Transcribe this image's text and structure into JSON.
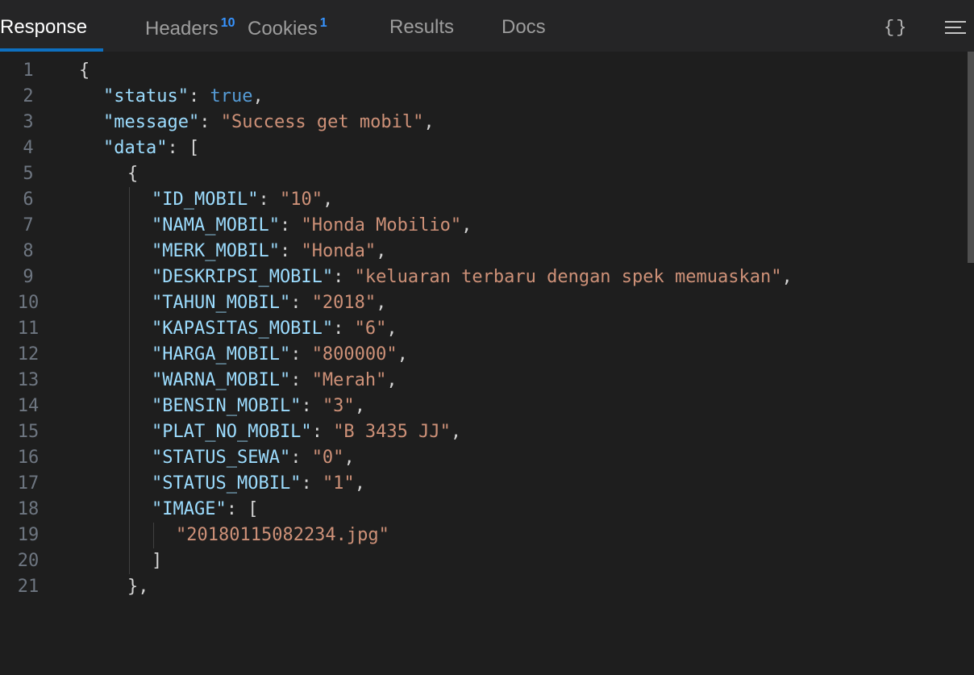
{
  "tabs": [
    {
      "label": "Response",
      "badge": "",
      "active": true
    },
    {
      "label": "Headers",
      "badge": "10",
      "active": false
    },
    {
      "label": "Cookies",
      "badge": "1",
      "active": false
    },
    {
      "label": "Results",
      "badge": "",
      "active": false
    },
    {
      "label": "Docs",
      "badge": "",
      "active": false
    }
  ],
  "toolbar": {
    "format_icon": "{}",
    "menu_icon": "hamburger-lines"
  },
  "editor": {
    "lines": [
      {
        "num": "1",
        "indent": 0,
        "tokens": [
          [
            "p",
            "{"
          ]
        ]
      },
      {
        "num": "2",
        "indent": 1,
        "tokens": [
          [
            "k",
            "\"status\""
          ],
          [
            "p",
            ": "
          ],
          [
            "b",
            "true"
          ],
          [
            "p",
            ","
          ]
        ]
      },
      {
        "num": "3",
        "indent": 1,
        "tokens": [
          [
            "k",
            "\"message\""
          ],
          [
            "p",
            ": "
          ],
          [
            "s",
            "\"Success get mobil\""
          ],
          [
            "p",
            ","
          ]
        ]
      },
      {
        "num": "4",
        "indent": 1,
        "tokens": [
          [
            "k",
            "\"data\""
          ],
          [
            "p",
            ": ["
          ]
        ]
      },
      {
        "num": "5",
        "indent": 2,
        "tokens": [
          [
            "p",
            "{"
          ]
        ]
      },
      {
        "num": "6",
        "indent": 3,
        "tokens": [
          [
            "k",
            "\"ID_MOBIL\""
          ],
          [
            "p",
            ": "
          ],
          [
            "s",
            "\"10\""
          ],
          [
            "p",
            ","
          ]
        ]
      },
      {
        "num": "7",
        "indent": 3,
        "tokens": [
          [
            "k",
            "\"NAMA_MOBIL\""
          ],
          [
            "p",
            ": "
          ],
          [
            "s",
            "\"Honda Mobilio\""
          ],
          [
            "p",
            ","
          ]
        ]
      },
      {
        "num": "8",
        "indent": 3,
        "tokens": [
          [
            "k",
            "\"MERK_MOBIL\""
          ],
          [
            "p",
            ": "
          ],
          [
            "s",
            "\"Honda\""
          ],
          [
            "p",
            ","
          ]
        ]
      },
      {
        "num": "9",
        "indent": 3,
        "tokens": [
          [
            "k",
            "\"DESKRIPSI_MOBIL\""
          ],
          [
            "p",
            ": "
          ],
          [
            "s",
            "\"keluaran terbaru dengan spek memuaskan\""
          ],
          [
            "p",
            ","
          ]
        ]
      },
      {
        "num": "10",
        "indent": 3,
        "tokens": [
          [
            "k",
            "\"TAHUN_MOBIL\""
          ],
          [
            "p",
            ": "
          ],
          [
            "s",
            "\"2018\""
          ],
          [
            "p",
            ","
          ]
        ]
      },
      {
        "num": "11",
        "indent": 3,
        "tokens": [
          [
            "k",
            "\"KAPASITAS_MOBIL\""
          ],
          [
            "p",
            ": "
          ],
          [
            "s",
            "\"6\""
          ],
          [
            "p",
            ","
          ]
        ]
      },
      {
        "num": "12",
        "indent": 3,
        "tokens": [
          [
            "k",
            "\"HARGA_MOBIL\""
          ],
          [
            "p",
            ": "
          ],
          [
            "s",
            "\"800000\""
          ],
          [
            "p",
            ","
          ]
        ]
      },
      {
        "num": "13",
        "indent": 3,
        "tokens": [
          [
            "k",
            "\"WARNA_MOBIL\""
          ],
          [
            "p",
            ": "
          ],
          [
            "s",
            "\"Merah\""
          ],
          [
            "p",
            ","
          ]
        ]
      },
      {
        "num": "14",
        "indent": 3,
        "tokens": [
          [
            "k",
            "\"BENSIN_MOBIL\""
          ],
          [
            "p",
            ": "
          ],
          [
            "s",
            "\"3\""
          ],
          [
            "p",
            ","
          ]
        ]
      },
      {
        "num": "15",
        "indent": 3,
        "tokens": [
          [
            "k",
            "\"PLAT_NO_MOBIL\""
          ],
          [
            "p",
            ": "
          ],
          [
            "s",
            "\"B 3435 JJ\""
          ],
          [
            "p",
            ","
          ]
        ]
      },
      {
        "num": "16",
        "indent": 3,
        "tokens": [
          [
            "k",
            "\"STATUS_SEWA\""
          ],
          [
            "p",
            ": "
          ],
          [
            "s",
            "\"0\""
          ],
          [
            "p",
            ","
          ]
        ]
      },
      {
        "num": "17",
        "indent": 3,
        "tokens": [
          [
            "k",
            "\"STATUS_MOBIL\""
          ],
          [
            "p",
            ": "
          ],
          [
            "s",
            "\"1\""
          ],
          [
            "p",
            ","
          ]
        ]
      },
      {
        "num": "18",
        "indent": 3,
        "tokens": [
          [
            "k",
            "\"IMAGE\""
          ],
          [
            "p",
            ": ["
          ]
        ]
      },
      {
        "num": "19",
        "indent": 4,
        "tokens": [
          [
            "s",
            "\"20180115082234.jpg\""
          ]
        ]
      },
      {
        "num": "20",
        "indent": 3,
        "tokens": [
          [
            "p",
            "]"
          ]
        ]
      },
      {
        "num": "21",
        "indent": 2,
        "tokens": [
          [
            "p",
            "},"
          ]
        ]
      }
    ]
  },
  "colors": {
    "background": "#1e1e1e",
    "key": "#9cdcfe",
    "string": "#ce9178",
    "boolean": "#569cd6",
    "line_number": "#6e7681",
    "badge": "#3794ff",
    "active_tab_underline": "#0e70c0"
  }
}
